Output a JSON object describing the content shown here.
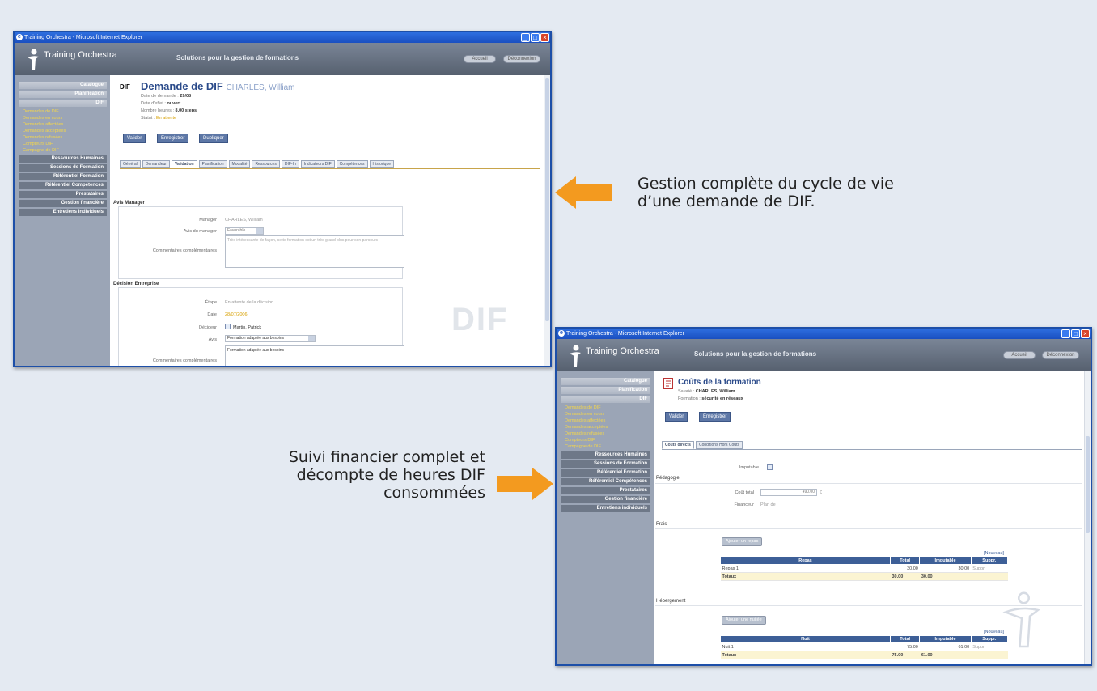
{
  "window1": {
    "title": "Training Orchestra - Microsoft Internet Explorer",
    "logo": "Training Orchestra",
    "slogan": "Solutions pour la gestion de formations",
    "header_buttons": [
      "Accueil",
      "Déconnexion"
    ],
    "sidebar": {
      "head1": "Catalogue",
      "head2": "Planification",
      "head3": "DIF",
      "items": [
        "Demandes de DIF",
        "Demandes en cours",
        "Demandes affectées",
        "Demandes acceptées",
        "Demandes refusées",
        "Compteurs DIF",
        "Campagne de DIF"
      ],
      "groups": [
        "Ressources Humaines",
        "Sessions de Formation",
        "Référentiel Formation",
        "Référentiel Compétences",
        "Prestataires",
        "Gestion financière",
        "Entretiens individuels"
      ]
    },
    "page": {
      "badge": "DIF",
      "title": "Demande de DIF",
      "subtitle": "CHARLES, William",
      "meta": [
        {
          "label": "Date de demande",
          "value": "29/08"
        },
        {
          "label": "Date d'effet",
          "value": "ouvert"
        },
        {
          "label": "Nombre heures",
          "value": "8.00 steps"
        },
        {
          "label": "Statut",
          "value": "En attente"
        }
      ],
      "buttons": [
        "Valider",
        "Enregistrer",
        "Dupliquer"
      ],
      "tabs": [
        "Général",
        "Demandeur",
        "Validation",
        "Planification",
        "Modalité",
        "Ressources",
        "DIF-In",
        "Indicateurs DIF",
        "Compétences",
        "Historique"
      ],
      "section1": "Avis Manager",
      "manager_label": "Manager",
      "manager_value": "CHARLES, William",
      "avis_label": "Avis du manager",
      "avis_value": "Favorable",
      "comment_label": "Commentaires complémentaires",
      "comment_value": "Très intéressante de façon, cette formation est un très grand plus pour son parcours",
      "section2": "Décision Entreprise",
      "etape_label": "Étape",
      "etape_value": "En attente de la décision",
      "date_label": "Date",
      "date_value": "28/07/2006",
      "decideur_label": "Décideur",
      "decideur_value": "Martin, Patrick",
      "avis2_label": "Avis",
      "avis2_value": "Formation adaptée aux besoins",
      "comment2_label": "Commentaires complémentaires",
      "comment2_value": "Formation adaptée aux besoins",
      "watermark": "DIF"
    }
  },
  "window2": {
    "title": "Training Orchestra - Microsoft Internet Explorer",
    "logo": "Training Orchestra",
    "slogan": "Solutions pour la gestion de formations",
    "header_buttons": [
      "Accueil",
      "Déconnexion"
    ],
    "page": {
      "title": "Coûts de la formation",
      "meta": [
        {
          "label": "Salarié",
          "value": "CHARLES, William"
        },
        {
          "label": "Formation",
          "value": "sécurité en réseaux"
        }
      ],
      "buttons": [
        "Valider",
        "Enregistrer"
      ],
      "tabs": [
        "Coûts directs",
        "Conditions Hors Coûts"
      ],
      "imputable_label": "Imputable",
      "section_pedagogie": "Pédagogie",
      "cout_label": "Coût total",
      "cout_value": "490.00",
      "cout_unit": "€",
      "financeur_label": "Financeur",
      "financeur_value": "Plan de",
      "section_frais": "Frais",
      "add_frais": "Ajouter un repas",
      "frais_table": {
        "link": "[Nouveau]",
        "headers": [
          "Repas",
          "Total",
          "Imputable",
          "Suppr."
        ],
        "rows": [
          {
            "name": "Repas 1",
            "total": "30.00",
            "imputable": "30.00",
            "action": "Suppr."
          }
        ],
        "total_row": {
          "name": "Totaux",
          "total": "30.00",
          "imputable": "30.00"
        }
      },
      "section_hebergement": "Hébergement",
      "add_heb": "Ajouter une nuitée",
      "heb_table": {
        "link": "[Nouveau]",
        "headers": [
          "Nuit",
          "Total",
          "Imputable",
          "Suppr."
        ],
        "rows": [
          {
            "name": "Nuit 1",
            "total": "75.00",
            "imputable": "61.00",
            "action": "Suppr."
          }
        ],
        "total_row": {
          "name": "Totaux",
          "total": "75.00",
          "imputable": "61.00"
        }
      }
    }
  },
  "callout1": [
    "Gestion complète du cycle de vie",
    "d’une demande de DIF."
  ],
  "callout2": [
    "Suivi financier complet et",
    "décompte de heures DIF",
    "consommées"
  ],
  "colors": {
    "arrow": "#f39a1f",
    "window_frame": "#1d4fa8",
    "header": "#5d6778",
    "sidebar": "#9ba5b6"
  }
}
